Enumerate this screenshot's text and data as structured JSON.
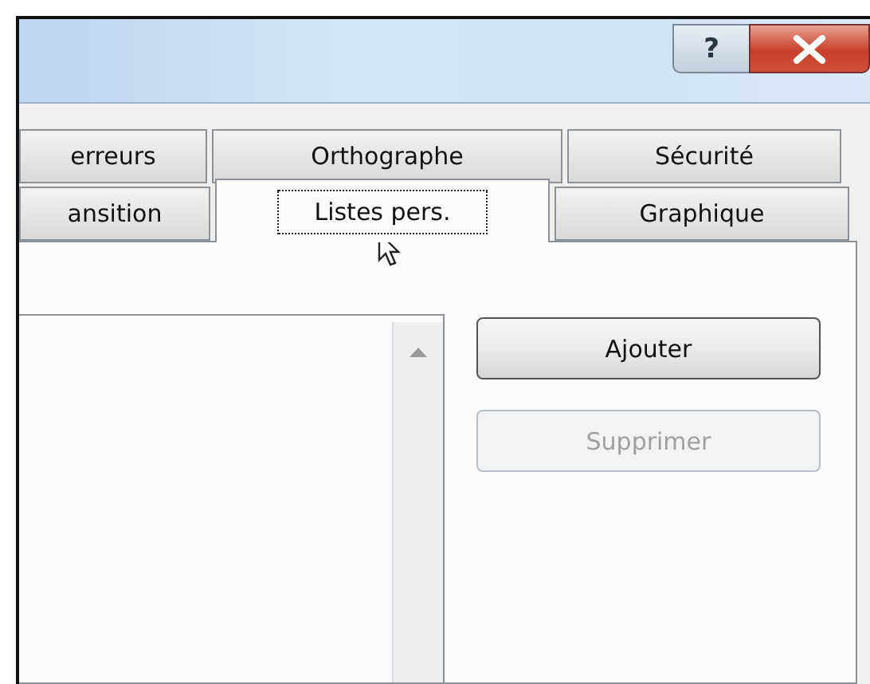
{
  "title_bar": {
    "help_button": "?"
  },
  "tab_rows": [
    [
      {
        "label": "erreurs",
        "selected": false
      },
      {
        "label": "Orthographe",
        "selected": false
      },
      {
        "label": "Sécurité",
        "selected": false
      }
    ],
    [
      {
        "label": "ansition",
        "selected": false
      },
      {
        "label": "Listes pers.",
        "selected": true
      },
      {
        "label": "Graphique",
        "selected": false
      }
    ]
  ],
  "buttons": [
    {
      "label": "Ajouter",
      "disabled": false
    },
    {
      "label": "Supprimer",
      "disabled": true
    }
  ]
}
